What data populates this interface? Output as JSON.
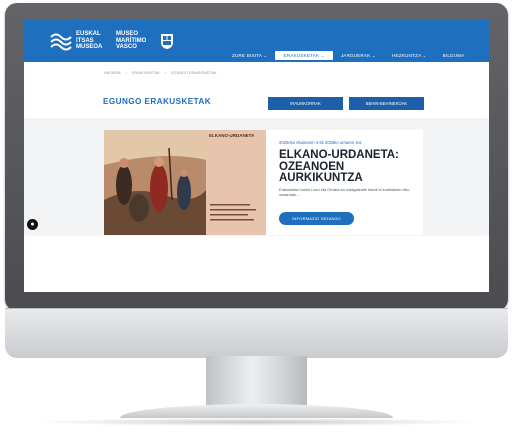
{
  "header": {
    "logo_left": [
      "EUSKAL",
      "ITSAS",
      "MUSEOA"
    ],
    "logo_right": [
      "MUSEO",
      "MARÍTIMO",
      "VASCO"
    ]
  },
  "nav": {
    "items": [
      {
        "label": "ZURE BISITA ⌄"
      },
      {
        "label": "ERAKUSKETAK ⌄"
      },
      {
        "label": "JARDUERAK ⌄"
      },
      {
        "label": "HEZKUNTZA ⌄"
      },
      {
        "label": "BILDUMA"
      }
    ]
  },
  "breadcrumb": [
    "HASIERA",
    "›",
    "ERAKUSKETAK",
    "›",
    "EGUNGO ERAKUSKETAK"
  ],
  "page": {
    "title": "EGUNGO ERAKUSKETAK",
    "tabs": [
      "IRAUNKORRAK",
      "BEHIN-BEHINEKOAK"
    ]
  },
  "poster": {
    "heading": "ELKANO-URDANETA"
  },
  "exhibit": {
    "date": "2025eko ekainaren 4-tik 2026ko urriaren 4ra",
    "title_lines": [
      "ELKANO-URDANETA:",
      "OZEANOEN",
      "AURKIKUNTZA"
    ],
    "description": "Erakusketa honek Lezo eta Ordizia-ko nabigatzaile handi bi irudikatzen ditu, ozeanoak...",
    "button_label": "INFORMAZIO GEHIAGO"
  },
  "colors": {
    "brand_blue": "#1f6fbf",
    "tab_blue": "#1d5fa8",
    "title_dark": "#1a2230"
  }
}
